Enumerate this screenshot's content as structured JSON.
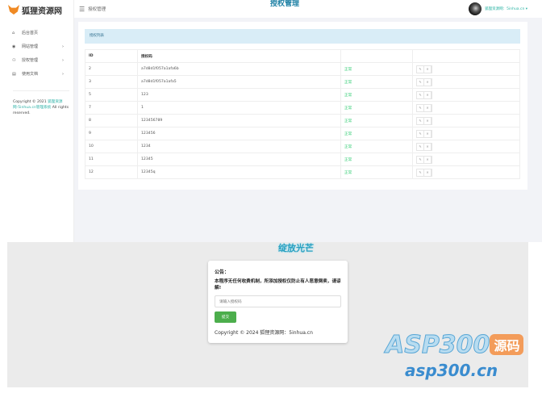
{
  "brand": {
    "logo_text": "狐狸资源网",
    "logo_sub": "www.5inhua.cn",
    "overlay_title": "授权管理"
  },
  "sidebar": {
    "items": [
      {
        "label": "后台首页",
        "icon": "home-icon"
      },
      {
        "label": "网站管理",
        "icon": "globe-icon"
      },
      {
        "label": "授权管理",
        "icon": "users-icon"
      },
      {
        "label": "使用文档",
        "icon": "document-icon"
      }
    ],
    "copyright_pre": "Copyright © 2021",
    "copyright_link": "狐狸资源网-5inhua.cn管理系统",
    "copyright_post": "All rights reserved."
  },
  "header": {
    "title": "授权管理",
    "user": "狐狸资源网：5inhua.cn ▾"
  },
  "panel": {
    "title": "授权列表",
    "columns": [
      "ID",
      "授权码",
      "",
      ""
    ],
    "rows": [
      {
        "id": "2",
        "code": "a7d8d1f057a1afa6b",
        "status": "正常"
      },
      {
        "id": "3",
        "code": "a7d8d1f057a1afa5",
        "status": "正常"
      },
      {
        "id": "5",
        "code": "123",
        "status": "正常"
      },
      {
        "id": "7",
        "code": "1",
        "status": "正常"
      },
      {
        "id": "8",
        "code": "123456789",
        "status": "正常"
      },
      {
        "id": "9",
        "code": "123456",
        "status": "正常"
      },
      {
        "id": "10",
        "code": "1234",
        "status": "正常"
      },
      {
        "id": "11",
        "code": "12345",
        "status": "正常"
      },
      {
        "id": "12",
        "code": "12345q",
        "status": "正常"
      }
    ]
  },
  "login": {
    "glow_title": "绽放光芒",
    "heading": "公告：",
    "message": "本程序无任何收费机制，所添加授权仅防止有人恶意倒卖，请谅解!",
    "placeholder": "请输入授权码",
    "submit": "提交",
    "copyright": "Copyright © 2024 狐狸资源网：5inhua.cn"
  },
  "watermark": {
    "text": "ASP300",
    "badge": "源码",
    "url": "asp300.cn"
  }
}
